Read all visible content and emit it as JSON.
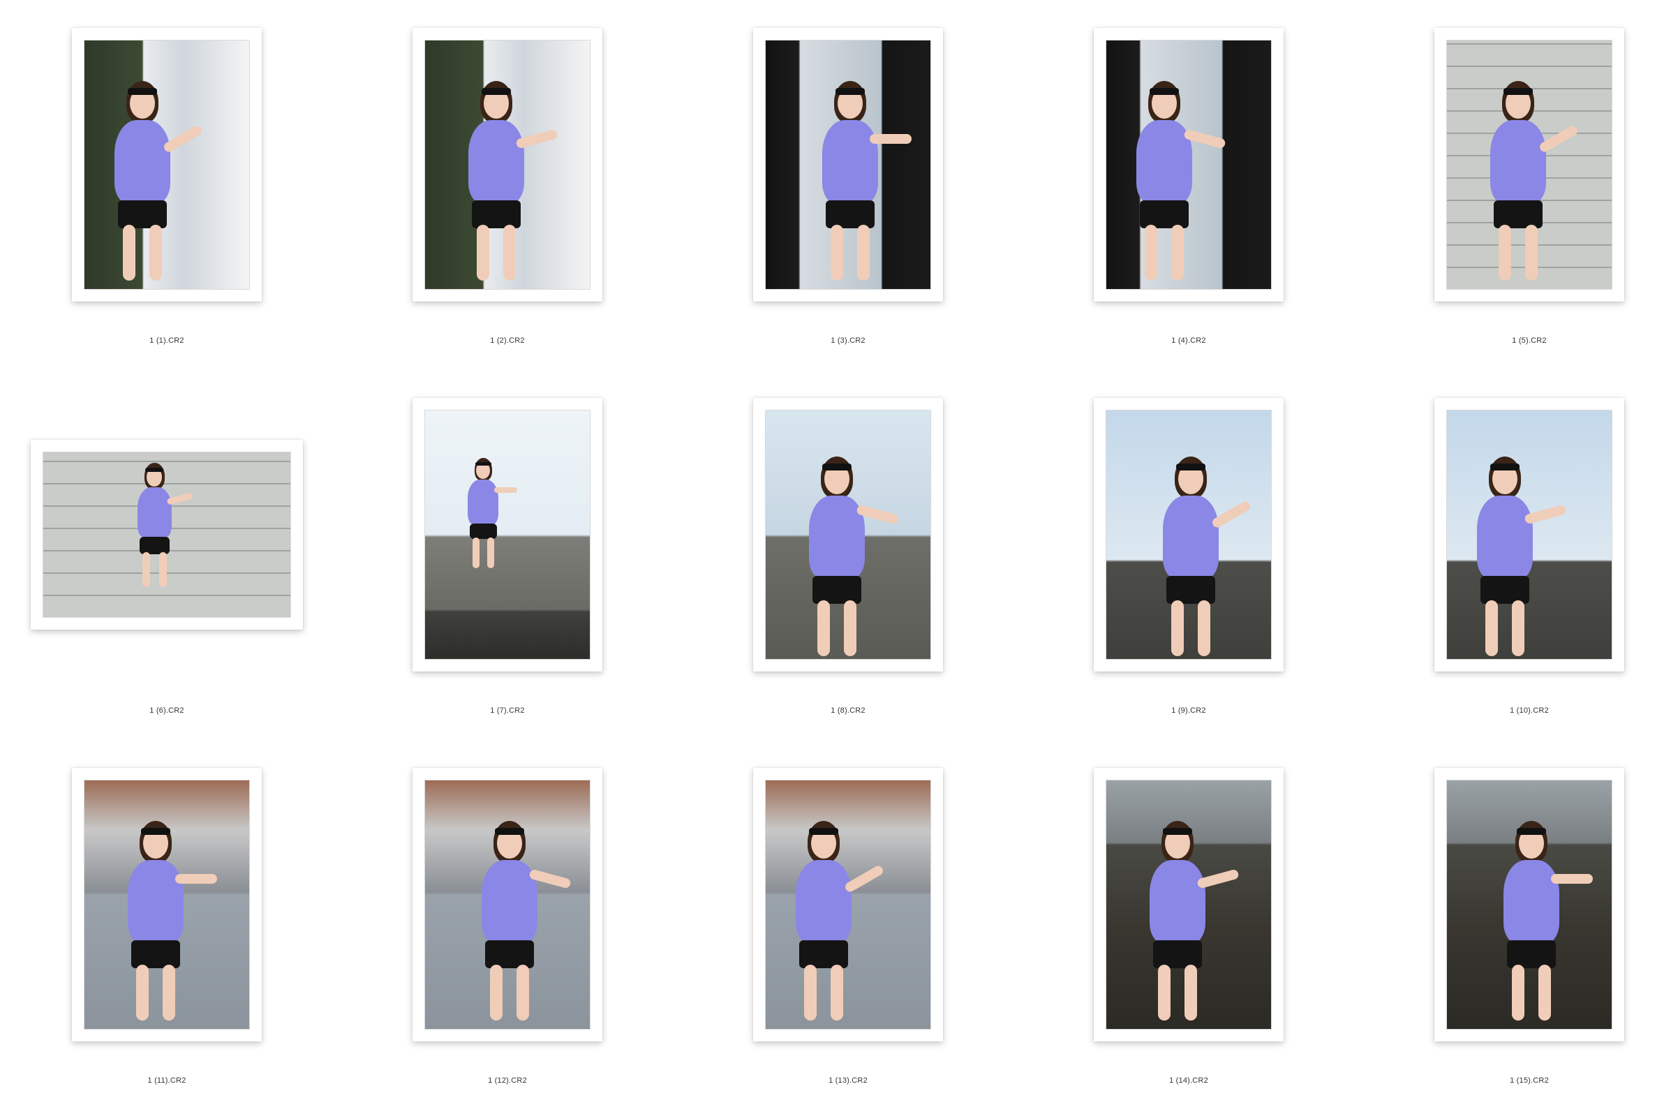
{
  "window": {
    "view": "file-icon-grid"
  },
  "colors": {
    "background": "#ffffff",
    "shirt": "#8b87e6",
    "shorts": "#141414",
    "skin": "#f0cdb8",
    "hair": "#3a2418",
    "label_text": "#333333"
  },
  "files": [
    {
      "name": "1 (1).CR2",
      "orientation": "portrait",
      "scene": "balcony-green"
    },
    {
      "name": "1 (2).CR2",
      "orientation": "portrait",
      "scene": "balcony-green"
    },
    {
      "name": "1 (3).CR2",
      "orientation": "portrait",
      "scene": "balcony-dark"
    },
    {
      "name": "1 (4).CR2",
      "orientation": "portrait",
      "scene": "balcony-dark"
    },
    {
      "name": "1 (5).CR2",
      "orientation": "portrait",
      "scene": "tile-wall"
    },
    {
      "name": "1 (6).CR2",
      "orientation": "landscape",
      "scene": "tile-wall"
    },
    {
      "name": "1 (7).CR2",
      "orientation": "portrait",
      "scene": "rooftop-jump"
    },
    {
      "name": "1 (8).CR2",
      "orientation": "portrait",
      "scene": "rooftop-wall"
    },
    {
      "name": "1 (9).CR2",
      "orientation": "portrait",
      "scene": "rooftop-sky"
    },
    {
      "name": "1 (10).CR2",
      "orientation": "portrait",
      "scene": "rooftop-sky"
    },
    {
      "name": "1 (11).CR2",
      "orientation": "portrait",
      "scene": "building-grey"
    },
    {
      "name": "1 (12).CR2",
      "orientation": "portrait",
      "scene": "building-grey"
    },
    {
      "name": "1 (13).CR2",
      "orientation": "portrait",
      "scene": "building-grey"
    },
    {
      "name": "1 (14).CR2",
      "orientation": "portrait",
      "scene": "stairs"
    },
    {
      "name": "1 (15).CR2",
      "orientation": "portrait",
      "scene": "stairs"
    }
  ]
}
